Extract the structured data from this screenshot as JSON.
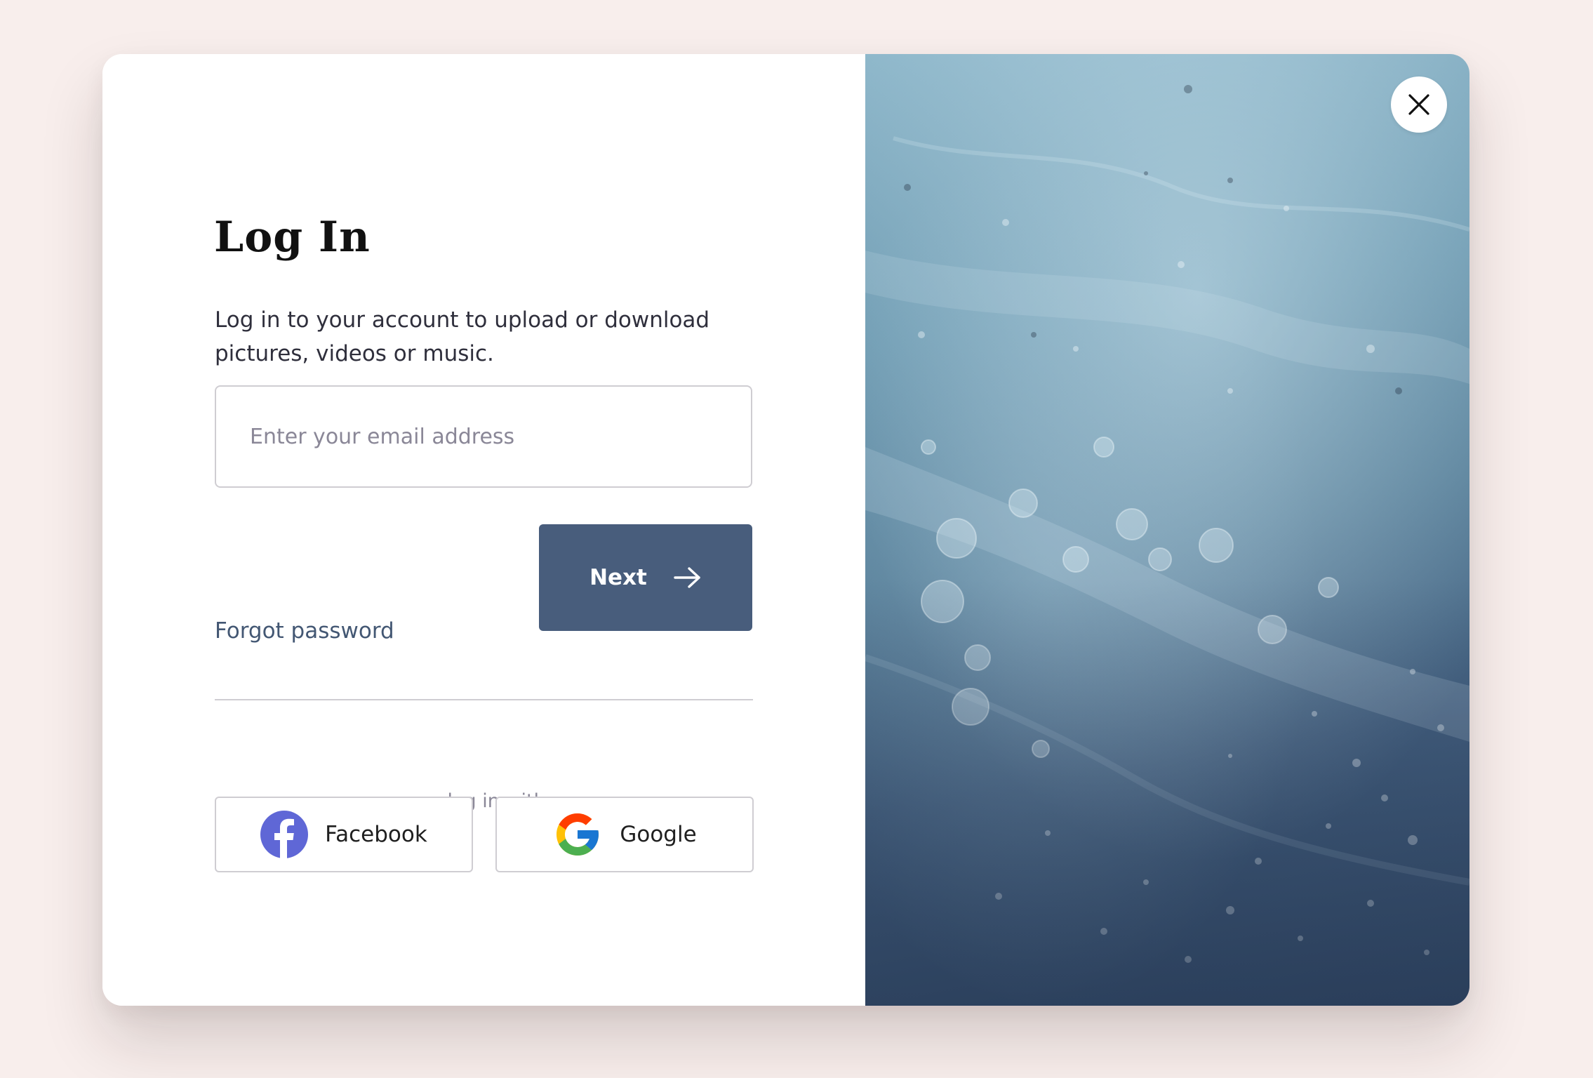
{
  "modal": {
    "title": "Log In",
    "subtitle": "Log in to your account to upload or download pictures, videos or music.",
    "email": {
      "placeholder": "Enter your email address",
      "value": ""
    },
    "forgot_password_label": "Forgot password",
    "next_button_label": "Next",
    "alt_login_text": "or log in with",
    "social": {
      "facebook_label": "Facebook",
      "google_label": "Google"
    },
    "icons": {
      "next": "arrow-right-icon",
      "close": "close-icon",
      "facebook": "facebook-icon",
      "google": "google-icon"
    },
    "image": "water-bubbles-photo"
  },
  "colors": {
    "background": "#f8eeec",
    "primary_button": "#485d7c",
    "link": "#435773",
    "facebook": "#5f67d6",
    "border": "#cfcdd2"
  }
}
